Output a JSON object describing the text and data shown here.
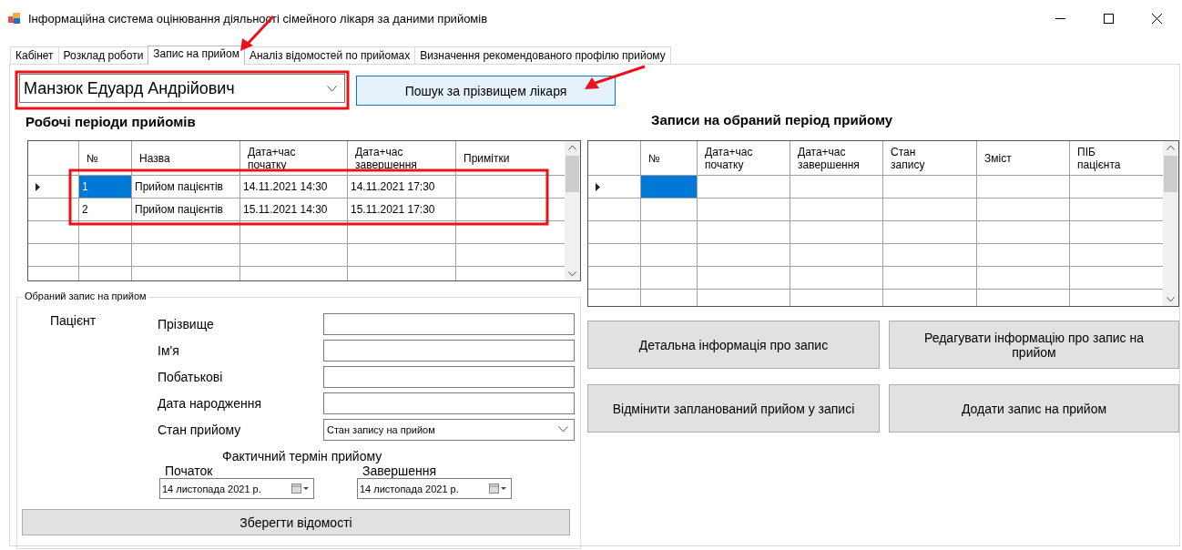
{
  "window": {
    "title": "Інформаційна система оцінювання діяльності сімейного лікаря за даними прийомів"
  },
  "tabs": [
    {
      "label": "Кабінет",
      "selected": false
    },
    {
      "label": "Розклад роботи",
      "selected": false
    },
    {
      "label": "Запис на прийом",
      "selected": true
    },
    {
      "label": "Аналіз відомостей по прийомах",
      "selected": false
    },
    {
      "label": "Визначення рекомендованого профілю прийому",
      "selected": false
    }
  ],
  "doctor_select": {
    "value": "Манзюк Едуард Андрійович"
  },
  "search_button": "Пошук за прізвищем лікаря",
  "periods": {
    "title": "Робочі періоди прийомів",
    "columns": [
      "№",
      "Назва",
      "Дата+час\nпочатку",
      "Дата+час\nзавершення",
      "Примітки"
    ],
    "rows": [
      {
        "number": "1",
        "name": "Прийом пацієнтів",
        "start": "14.11.2021 14:30",
        "end": "14.11.2021 17:30",
        "selected": true
      },
      {
        "number": "2",
        "name": "Прийом пацієнтів",
        "start": "15.11.2021 14:30",
        "end": "15.11.2021 17:30",
        "selected": false
      }
    ]
  },
  "selected_record": {
    "legend": "Обраний запис на прийом",
    "patient_label": "Пацієнт",
    "fields": [
      {
        "label": "Прізвище"
      },
      {
        "label": "Ім'я"
      },
      {
        "label": "Побатькові"
      },
      {
        "label": "Дата народження"
      }
    ],
    "status": {
      "label": "Стан прийому",
      "value": "Стан запису на прийом"
    },
    "actual_term": {
      "title": "Фактичний термін прийому",
      "start": {
        "label": "Початок",
        "value": "14 листопада 2021 р."
      },
      "end": {
        "label": "Завершення",
        "value": "14 листопада 2021 р."
      }
    },
    "save_button": "Зберегти відомості"
  },
  "records": {
    "title": "Записи на обраний період прийому",
    "columns": [
      "№",
      "Дата+час\nпочатку",
      "Дата+час\nзавершення",
      "Стан\nзапису",
      "Зміст",
      "ПІБ\nпацієнта"
    ],
    "new_row_selected": true
  },
  "actions": [
    "Детальна інформація про запис",
    "Редагувати інформацію про запис на прийом",
    "Відмінити запланований прийом у записі",
    "Додати запис на прийом"
  ]
}
